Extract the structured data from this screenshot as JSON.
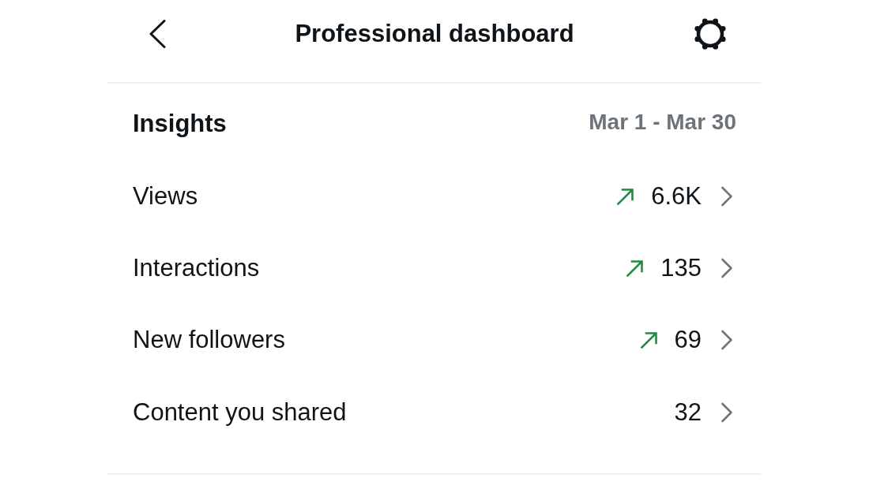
{
  "header": {
    "title": "Professional dashboard"
  },
  "insights": {
    "title": "Insights",
    "date_range": "Mar 1 - Mar 30",
    "metrics": [
      {
        "label": "Views",
        "value": "6.6K",
        "trending_up": true
      },
      {
        "label": "Interactions",
        "value": "135",
        "trending_up": true
      },
      {
        "label": "New followers",
        "value": "69",
        "trending_up": true
      },
      {
        "label": "Content you shared",
        "value": "32",
        "trending_up": false
      }
    ]
  }
}
